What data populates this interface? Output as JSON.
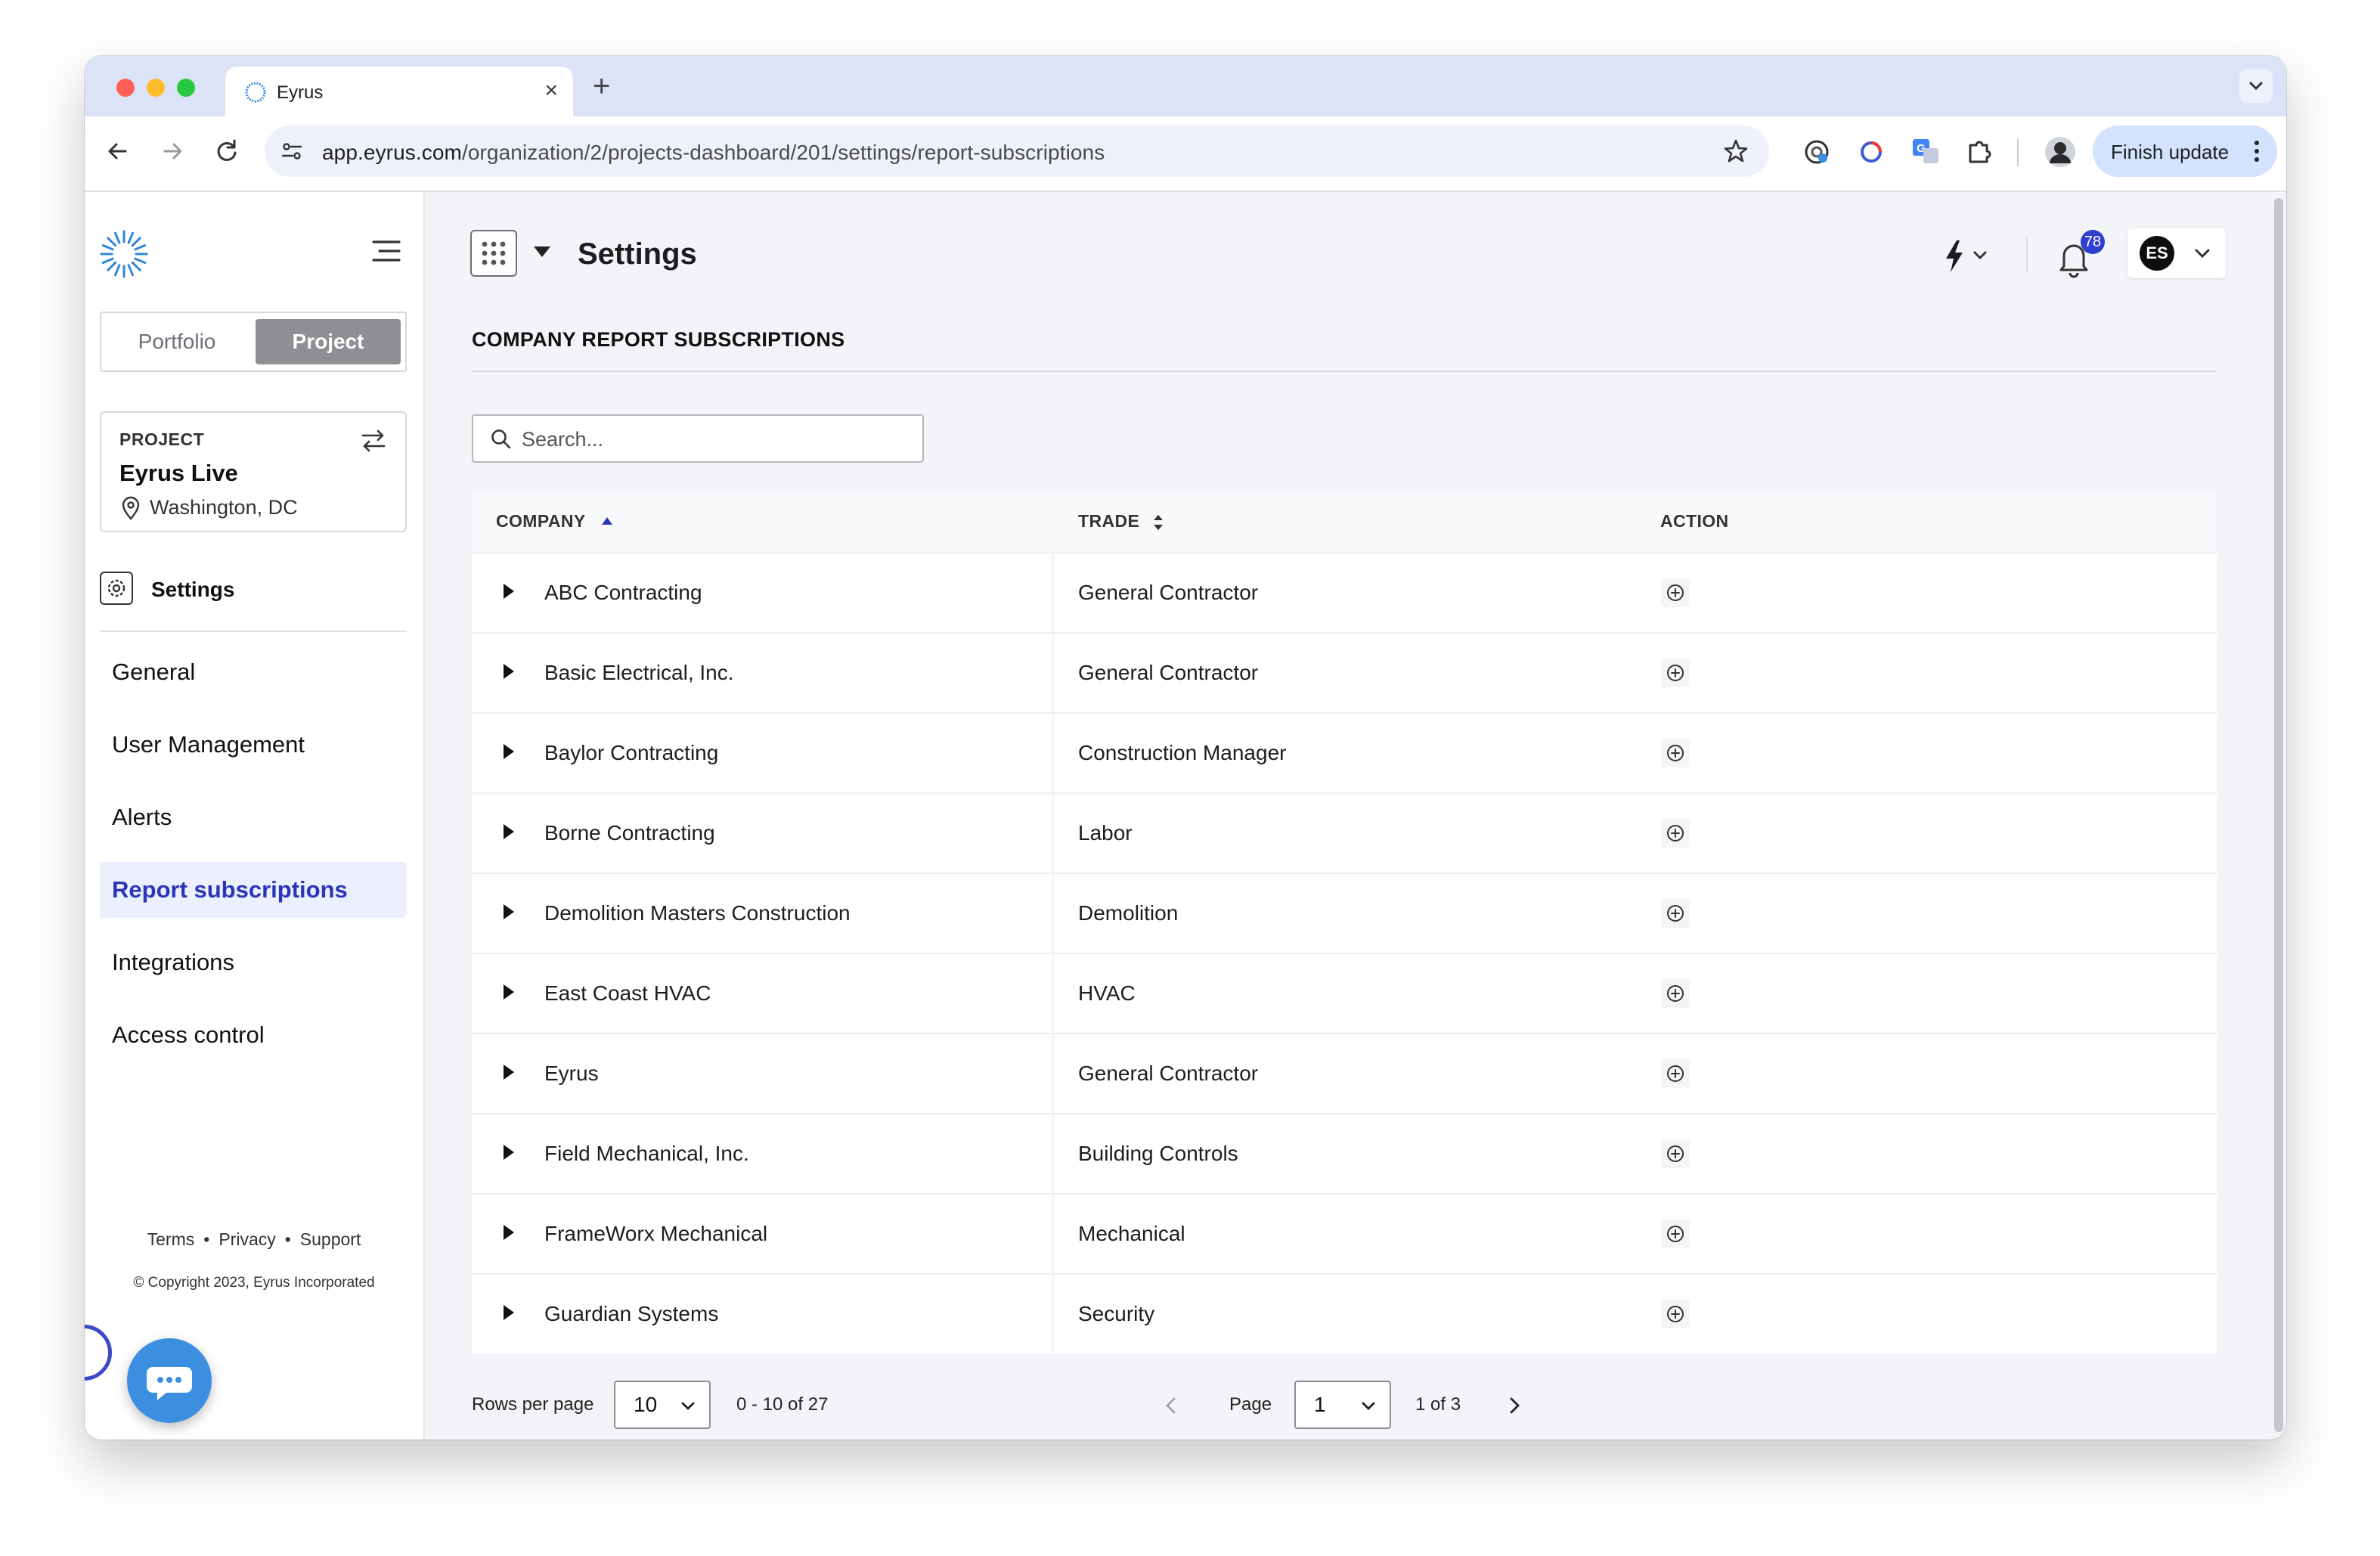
{
  "browser": {
    "tab_title": "Eyrus",
    "url_host": "app.eyrus.com",
    "url_path": "/organization/2/projects-dashboard/201/settings/report-subscriptions",
    "update_label": "Finish update"
  },
  "sidebar": {
    "segment": {
      "portfolio": "Portfolio",
      "project": "Project"
    },
    "project_card": {
      "kicker": "PROJECT",
      "name": "Eyrus Live",
      "location": "Washington, DC"
    },
    "section_label": "Settings",
    "items": [
      {
        "label": "General",
        "active": false
      },
      {
        "label": "User Management",
        "active": false
      },
      {
        "label": "Alerts",
        "active": false
      },
      {
        "label": "Report subscriptions",
        "active": true
      },
      {
        "label": "Integrations",
        "active": false
      },
      {
        "label": "Access control",
        "active": false
      }
    ],
    "footer": {
      "terms": "Terms",
      "privacy": "Privacy",
      "support": "Support",
      "separator": "•"
    },
    "copyright": "© Copyright 2023, Eyrus Incorporated"
  },
  "header": {
    "title": "Settings",
    "notification_count": "78",
    "user_initials": "ES"
  },
  "main": {
    "section_title": "COMPANY REPORT SUBSCRIPTIONS",
    "search": {
      "placeholder": "Search...",
      "value": ""
    },
    "table": {
      "columns": {
        "company": "COMPANY",
        "trade": "TRADE",
        "action": "ACTION"
      },
      "rows": [
        {
          "company": "ABC Contracting",
          "trade": "General Contractor"
        },
        {
          "company": "Basic Electrical, Inc.",
          "trade": "General Contractor"
        },
        {
          "company": "Baylor Contracting",
          "trade": "Construction Manager"
        },
        {
          "company": "Borne Contracting",
          "trade": "Labor"
        },
        {
          "company": "Demolition Masters Construction",
          "trade": "Demolition"
        },
        {
          "company": "East Coast HVAC",
          "trade": "HVAC"
        },
        {
          "company": "Eyrus",
          "trade": "General Contractor"
        },
        {
          "company": "Field Mechanical, Inc.",
          "trade": "Building Controls"
        },
        {
          "company": "FrameWorx Mechanical",
          "trade": "Mechanical"
        },
        {
          "company": "Guardian Systems",
          "trade": "Security"
        }
      ]
    },
    "pagination": {
      "rows_per_page_label": "Rows per page",
      "rows_per_page": "10",
      "range": "0 - 10 of 27",
      "page_label": "Page",
      "page": "1",
      "of_pages": "1 of 3"
    }
  },
  "colors": {
    "accent": "#2a36b8",
    "active_bg": "#eceffd",
    "chat_bubble": "#3b8ee0",
    "badge": "#2f3fd0"
  }
}
